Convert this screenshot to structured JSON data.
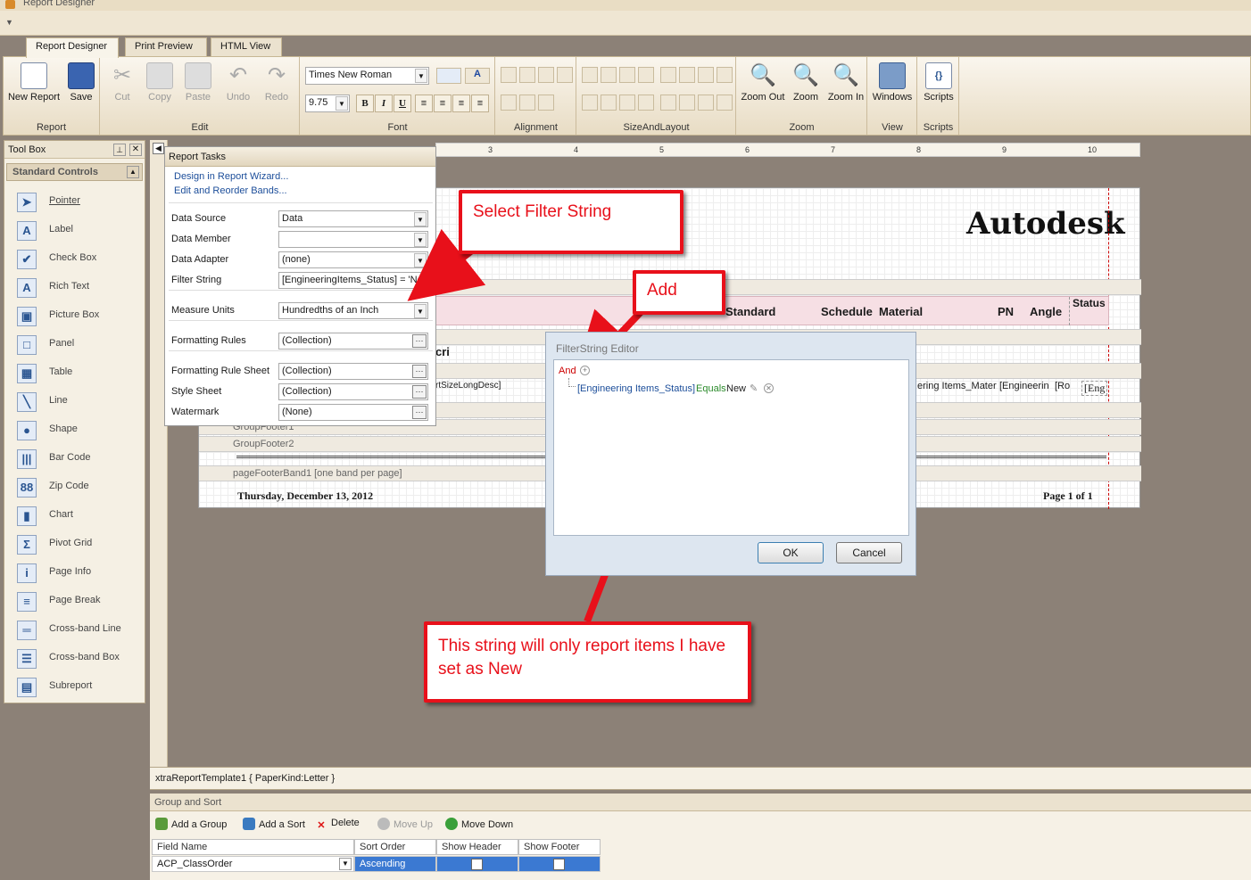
{
  "window": {
    "title": "Report Designer"
  },
  "tabs": [
    "Report Designer",
    "Print Preview",
    "HTML View"
  ],
  "ribbon": {
    "report": {
      "label": "Report",
      "new_report": "New Report",
      "save": "Save"
    },
    "edit": {
      "label": "Edit",
      "cut": "Cut",
      "copy": "Copy",
      "paste": "Paste",
      "undo": "Undo",
      "redo": "Redo"
    },
    "font": {
      "label": "Font",
      "family": "Times New Roman",
      "size": "9.75",
      "bold": "B",
      "italic": "I",
      "underline": "U"
    },
    "alignment": {
      "label": "Alignment"
    },
    "size_layout": {
      "label": "SizeAndLayout"
    },
    "zoom": {
      "label": "Zoom",
      "zoom_out": "Zoom Out",
      "zoom": "Zoom",
      "zoom_in": "Zoom In"
    },
    "view": {
      "label": "View",
      "windows": "Windows"
    },
    "scripts": {
      "label": "Scripts",
      "scripts": "Scripts"
    }
  },
  "toolbox": {
    "title": "Tool Box",
    "group": "Standard Controls",
    "items": [
      {
        "label": "Pointer",
        "icon": "pointer-icon",
        "glyph": "➤"
      },
      {
        "label": "Label",
        "icon": "label-icon",
        "glyph": "A"
      },
      {
        "label": "Check Box",
        "icon": "checkbox-icon",
        "glyph": "✔"
      },
      {
        "label": "Rich Text",
        "icon": "rich-text-icon",
        "glyph": "A"
      },
      {
        "label": "Picture Box",
        "icon": "picture-box-icon",
        "glyph": "▣"
      },
      {
        "label": "Panel",
        "icon": "panel-icon",
        "glyph": "□"
      },
      {
        "label": "Table",
        "icon": "table-icon",
        "glyph": "▦"
      },
      {
        "label": "Line",
        "icon": "line-icon",
        "glyph": "╲"
      },
      {
        "label": "Shape",
        "icon": "shape-icon",
        "glyph": "●"
      },
      {
        "label": "Bar Code",
        "icon": "barcode-icon",
        "glyph": "|||"
      },
      {
        "label": "Zip Code",
        "icon": "zipcode-icon",
        "glyph": "88"
      },
      {
        "label": "Chart",
        "icon": "chart-icon",
        "glyph": "▮"
      },
      {
        "label": "Pivot Grid",
        "icon": "pivot-grid-icon",
        "glyph": "Σ"
      },
      {
        "label": "Page Info",
        "icon": "page-info-icon",
        "glyph": "i"
      },
      {
        "label": "Page Break",
        "icon": "page-break-icon",
        "glyph": "≡"
      },
      {
        "label": "Cross-band Line",
        "icon": "cross-band-line-icon",
        "glyph": "═"
      },
      {
        "label": "Cross-band Box",
        "icon": "cross-band-box-icon",
        "glyph": "☰"
      },
      {
        "label": "Subreport",
        "icon": "subreport-icon",
        "glyph": "▤"
      }
    ]
  },
  "report_tasks": {
    "title": "Report Tasks",
    "links": [
      "Design in Report Wizard...",
      "Edit and Reorder Bands..."
    ],
    "rows": [
      {
        "label": "Data Source",
        "value": "Data",
        "editor": "dropdown"
      },
      {
        "label": "Data Member",
        "value": "",
        "editor": "dropdown"
      },
      {
        "label": "Data Adapter",
        "value": "(none)",
        "editor": "dropdown"
      },
      {
        "label": "Filter String",
        "value": "[EngineeringItems_Status] = 'Ne",
        "editor": "text"
      },
      {
        "label": "Measure Units",
        "value": "Hundredths of an Inch",
        "editor": "dropdown"
      },
      {
        "label": "Formatting Rules",
        "value": "(Collection)",
        "editor": "ellipsis"
      },
      {
        "label": "Formatting Rule Sheet",
        "value": "(Collection)",
        "editor": "ellipsis"
      },
      {
        "label": "Style Sheet",
        "value": "(Collection)",
        "editor": "ellipsis"
      },
      {
        "label": "Watermark",
        "value": "(None)",
        "editor": "ellipsis"
      }
    ]
  },
  "report": {
    "logo": "Autodesk",
    "header_cols": [
      "Standard",
      "Schedule",
      "Material",
      "PN",
      "Angle",
      "Status"
    ],
    "detail_cells": [
      "cri",
      "rtSizeLongDesc]",
      "ering Items_Mater",
      "[Engineerin",
      "[Ro",
      "[Eng"
    ],
    "bands": [
      "GroupFooter1",
      "GroupFooter2",
      "pageFooterBand1 [one band per page]"
    ],
    "footer_date": "Thursday, December 13, 2012",
    "footer_page": "Page 1 of 1"
  },
  "filter_editor": {
    "title": "FilterString Editor",
    "group_op": "And",
    "condition": {
      "field": "[Engineering Items_Status]",
      "op": "Equals",
      "value": "New"
    },
    "ok": "OK",
    "cancel": "Cancel"
  },
  "callouts": {
    "select": "Select Filter String",
    "add": "Add",
    "note": "This string will only report items I have set as New"
  },
  "status": {
    "text": "xtraReportTemplate1 { PaperKind:Letter }"
  },
  "group_sort": {
    "title": "Group and Sort",
    "toolbar": {
      "add_group": "Add a Group",
      "add_sort": "Add a Sort",
      "delete": "Delete",
      "move_up": "Move Up",
      "move_down": "Move Down"
    },
    "columns": [
      "Field Name",
      "Sort Order",
      "Show Header",
      "Show Footer"
    ],
    "row": {
      "field": "ACP_ClassOrder",
      "order": "Ascending"
    }
  },
  "ruler_ticks": [
    "3",
    "4",
    "5",
    "6",
    "7",
    "8",
    "9",
    "10"
  ]
}
